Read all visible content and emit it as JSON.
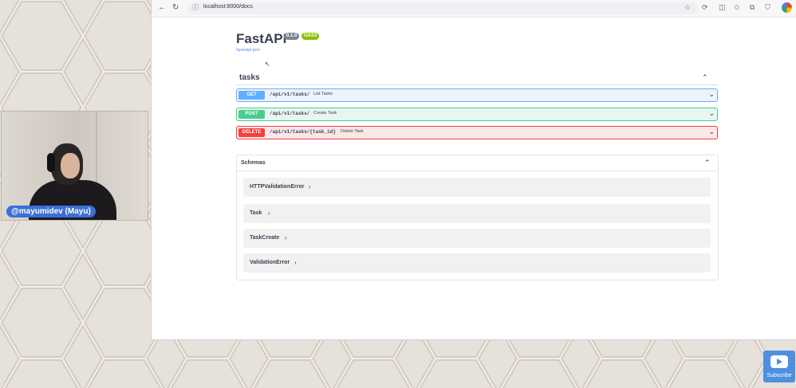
{
  "streamer": {
    "tag": "@mayumidev (Mayu)"
  },
  "browser": {
    "url": "localhost:8000/docs",
    "back_icon": "arrow-left",
    "reload_icon": "refresh"
  },
  "api": {
    "title": "FastAPI",
    "version": "0.1.0",
    "oas_badge": "OAS3",
    "openapi_link": "/openapi.json"
  },
  "tasks_section": {
    "title": "tasks",
    "operations": [
      {
        "method": "GET",
        "path": "/api/v1/tasks/",
        "summary": "List Tasks",
        "color": "#61affe"
      },
      {
        "method": "POST",
        "path": "/api/v1/tasks/",
        "summary": "Create Task",
        "color": "#49cc90"
      },
      {
        "method": "DELETE",
        "path": "/api/v1/tasks/{task_id}",
        "summary": "Delete Task",
        "color": "#f93e3e"
      }
    ]
  },
  "schemas": {
    "title": "Schemas",
    "items": [
      "HTTPValidationError",
      "Task",
      "TaskCreate",
      "ValidationError"
    ]
  },
  "subscribe": {
    "label": "Subscribe"
  }
}
